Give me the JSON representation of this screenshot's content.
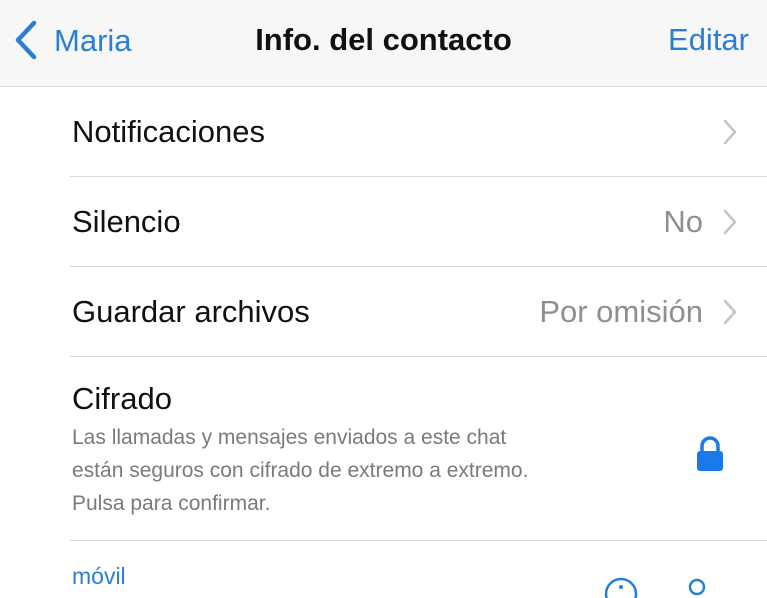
{
  "navbar": {
    "back_label": "Maria",
    "title": "Info. del contacto",
    "edit_label": "Editar"
  },
  "rows": [
    {
      "label": "Notificaciones",
      "value": ""
    },
    {
      "label": "Silencio",
      "value": "No"
    },
    {
      "label": "Guardar archivos",
      "value": "Por omisión"
    }
  ],
  "encryption": {
    "title": "Cifrado",
    "description_lines": [
      "Las llamadas y mensajes enviados a este chat",
      "están seguros con cifrado de extremo a extremo.",
      "Pulsa para confirmar."
    ],
    "icon": "lock-icon"
  },
  "phone": {
    "label": "móvil",
    "icons": [
      "info-icon",
      "contact-icon"
    ]
  },
  "colors": {
    "accent": "#2a7fd4",
    "secondary_text": "#8e8e93",
    "separator": "#d9d9d9",
    "navbar_bg": "#f7f7f7"
  }
}
